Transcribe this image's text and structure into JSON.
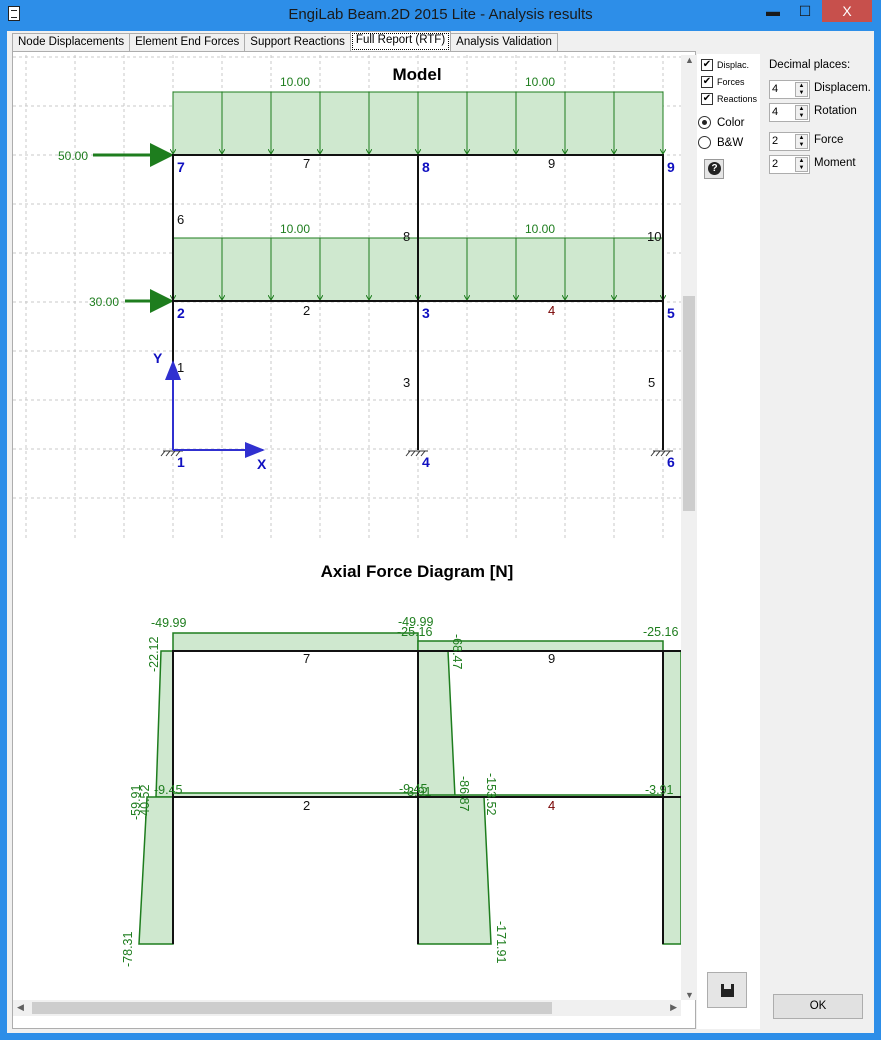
{
  "window": {
    "title": "EngiLab Beam.2D 2015 Lite - Analysis results",
    "minimize": "▬",
    "maximize": "☐",
    "close": "X"
  },
  "tabs": [
    {
      "label": "Node Displacements"
    },
    {
      "label": "Element End Forces"
    },
    {
      "label": "Support Reactions"
    },
    {
      "label": "Full Report (RTF)",
      "active": true
    },
    {
      "label": "Analysis Validation"
    }
  ],
  "options": {
    "displac": {
      "label": "Displac.",
      "checked": true
    },
    "forces": {
      "label": "Forces",
      "checked": true
    },
    "reactions": {
      "label": "Reactions",
      "checked": true
    },
    "color": {
      "label": "Color",
      "selected": true
    },
    "bw": {
      "label": "B&W",
      "selected": false
    }
  },
  "decimal": {
    "header": "Decimal places:",
    "displacem": {
      "label": "Displacem.",
      "value": "4"
    },
    "rotation": {
      "label": "Rotation",
      "value": "4"
    },
    "force": {
      "label": "Force",
      "value": "2"
    },
    "moment": {
      "label": "Moment",
      "value": "2"
    }
  },
  "ok_label": "OK",
  "model": {
    "title": "Model",
    "loads": {
      "dist_top_left": "10.00",
      "dist_top_right": "10.00",
      "dist_mid_left": "10.00",
      "dist_mid_right": "10.00",
      "point_top": "50.00",
      "point_mid": "30.00"
    },
    "nodes": [
      "1",
      "2",
      "3",
      "4",
      "5",
      "6",
      "7",
      "8",
      "9"
    ],
    "elements": [
      "1",
      "2",
      "3",
      "4",
      "5",
      "6",
      "7",
      "8",
      "9",
      "10"
    ],
    "axis_x": "X",
    "axis_y": "Y"
  },
  "axial": {
    "title": "Axial Force Diagram [N]",
    "values": {
      "b7_left": "-49.99",
      "b7_right": "-49.99",
      "b9_left": "-25.16",
      "b9_right": "-25.16",
      "c6_top": "-22.12",
      "c8_top": "-68.47",
      "c6_bot": "-40.52",
      "c1_top": "-59.91",
      "b2_left": "-9.45",
      "b2_right": "-9.45",
      "b4_left": "-3.91",
      "b4_right": "-3.91",
      "c8_bot": "-86.87",
      "c3_top": "-153.52",
      "c1_bot": "-78.31",
      "c3_bot": "-171.91"
    }
  },
  "colors": {
    "accent": "#2d8ee8",
    "load": "#1e7d1e",
    "fill": "#cfe8cf",
    "node": "#1010c0"
  }
}
